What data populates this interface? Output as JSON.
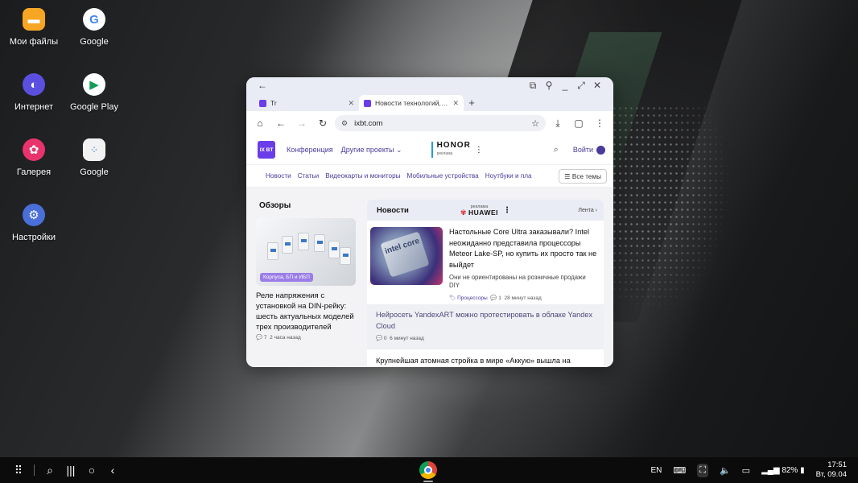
{
  "desktop": {
    "icons": [
      {
        "label": "Мои файлы",
        "icon": "folder-icon",
        "color": "#f6a623"
      },
      {
        "label": "Google",
        "icon": "google-icon",
        "color": "#ffffff"
      },
      {
        "label": "Интернет",
        "icon": "samsung-internet-icon",
        "color": "#5b4fe0"
      },
      {
        "label": "Google Play",
        "icon": "google-play-icon",
        "color": "#ffffff"
      },
      {
        "label": "Галерея",
        "icon": "gallery-icon",
        "color": "#e8336d"
      },
      {
        "label": "Google",
        "icon": "google-folder-icon",
        "color": "#f2f2f2"
      },
      {
        "label": "Настройки",
        "icon": "settings-gear-icon",
        "color": "#4a6fd8"
      }
    ]
  },
  "browser": {
    "tabs": [
      {
        "title": "Tr",
        "active": false
      },
      {
        "title": "Новости технологий, обзо",
        "active": true
      }
    ],
    "url": "ixbt.com"
  },
  "site": {
    "logo_text": "IX BT",
    "header": {
      "conferences": "Конференция",
      "other_projects": "Другие проекты",
      "sponsor_name": "HONOR",
      "sponsor_note": "реклама",
      "login": "Войти"
    },
    "nav": [
      "Новости",
      "Статьи",
      "Видеокарты и мониторы",
      "Мобильные устройства",
      "Ноутбуки и пла"
    ],
    "all_topics": "Все темы",
    "reviews": {
      "heading": "Обзоры",
      "badge": "Корпуса, БП и ИБП",
      "title": "Реле напряжения с установкой на DIN-рейку: шесть актуальных моделей трех производителей",
      "comments": "7",
      "time": "2 часа назад"
    },
    "news": {
      "heading": "Новости",
      "ad_label": "реклама",
      "ad_brand": "HUAWEI",
      "feed_link": "Лента",
      "items": [
        {
          "title": "Настольные Core Ultra заказывали? Intel неожиданно представила процессоры Meteor Lake-SP, но купить их просто так не выйдет",
          "subtitle": "Они не ориентированы на розничные продажи DIY",
          "tag": "Процессоры",
          "comments": "1",
          "time": "28 минут назад",
          "image_text": "intel core"
        },
        {
          "title": "Нейросеть YandexART можно протестировать в облаке Yandex Cloud",
          "comments": "0",
          "time": "6 минут назад"
        },
        {
          "title": "Крупнейшая атомная стройка в мире «Аккую» вышла на"
        }
      ]
    }
  },
  "taskbar": {
    "language": "EN",
    "battery": "82%",
    "time": "17:51",
    "date": "Вт, 09.04"
  }
}
